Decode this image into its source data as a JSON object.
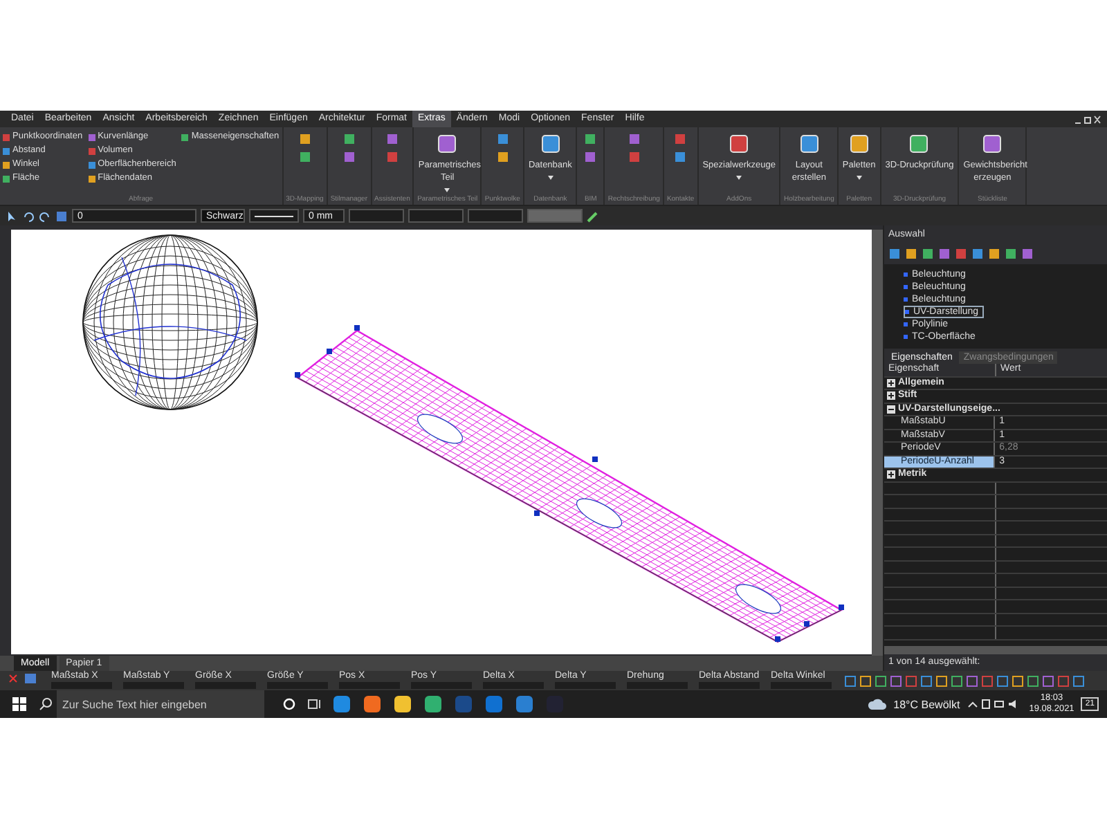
{
  "menu": [
    {
      "label": "Datei",
      "selected": false
    },
    {
      "label": "Bearbeiten",
      "selected": false
    },
    {
      "label": "Ansicht",
      "selected": false
    },
    {
      "label": "Arbeitsbereich",
      "selected": false
    },
    {
      "label": "Zeichnen",
      "selected": false
    },
    {
      "label": "Einfügen",
      "selected": false
    },
    {
      "label": "Architektur",
      "selected": false
    },
    {
      "label": "Format",
      "selected": false
    },
    {
      "label": "Extras",
      "selected": true
    },
    {
      "label": "Ändern",
      "selected": false
    },
    {
      "label": "Modi",
      "selected": false
    },
    {
      "label": "Optionen",
      "selected": false
    },
    {
      "label": "Fenster",
      "selected": false
    },
    {
      "label": "Hilfe",
      "selected": false
    }
  ],
  "ribbon": [
    {
      "label": "Abfrage",
      "kind": "small",
      "items": [
        "Punktkoordinaten",
        "Abstand",
        "Winkel",
        "Fläche",
        "Kurvenlänge",
        "Volumen",
        "Oberflächenbereich",
        "Flächendaten",
        "Masseneigenschaften"
      ]
    },
    {
      "label": "3D-Mapping",
      "kind": "icons"
    },
    {
      "label": "Stilmanager",
      "kind": "icons"
    },
    {
      "label": "Assistenten",
      "kind": "icons"
    },
    {
      "label": "Parametrisches Teil",
      "kind": "large",
      "button": "Parametrisches Teil",
      "dropdown": true
    },
    {
      "label": "Punktwolke",
      "kind": "icons"
    },
    {
      "label": "Datenbank",
      "kind": "large",
      "button": "Datenbank",
      "dropdown": true
    },
    {
      "label": "BIM",
      "kind": "icons"
    },
    {
      "label": "Rechtschreibung",
      "kind": "icons"
    },
    {
      "label": "Kontakte",
      "kind": "icons"
    },
    {
      "label": "AddOns",
      "kind": "large",
      "button": "Spezialwerkzeuge",
      "dropdown": true
    },
    {
      "label": "Holzbearbeitung",
      "kind": "large",
      "button": "Layout erstellen",
      "dropdown": false
    },
    {
      "label": "Paletten",
      "kind": "large",
      "button": "Paletten",
      "dropdown": true
    },
    {
      "label": "3D-Druckprüfung",
      "kind": "large",
      "button": "3D-Druckprüfung",
      "dropdown": false
    },
    {
      "label": "Stückliste",
      "kind": "large",
      "button": "Gewichtsbericht erzeugen",
      "dropdown": false
    }
  ],
  "toolbar": {
    "layer": "0",
    "pen": "Schwarz",
    "lineweight": "0 mm"
  },
  "selection_panel": {
    "title": "Auswahl",
    "tree": [
      {
        "label": "Beleuchtung",
        "selected": false
      },
      {
        "label": "Beleuchtung",
        "selected": false
      },
      {
        "label": "Beleuchtung",
        "selected": false
      },
      {
        "label": "UV-Darstellung",
        "selected": true
      },
      {
        "label": "Polylinie",
        "selected": false
      },
      {
        "label": "TC-Oberfläche",
        "selected": false
      }
    ],
    "tabs": [
      {
        "label": "Eigenschaften",
        "selected": true
      },
      {
        "label": "Zwangsbedingungen",
        "selected": false
      }
    ],
    "columns": [
      "Eigenschaft",
      "Wert"
    ],
    "sections": [
      {
        "label": "Allgemein",
        "expanded": false
      },
      {
        "label": "Stift",
        "expanded": false
      },
      {
        "label": "UV-Darstellungseige...",
        "expanded": true,
        "rows": [
          {
            "name": "MaßstabU",
            "value": "1",
            "disabled": false,
            "selected": false
          },
          {
            "name": "MaßstabV",
            "value": "1",
            "disabled": false,
            "selected": false
          },
          {
            "name": "PeriodeV",
            "value": "6,28",
            "disabled": true,
            "selected": false
          },
          {
            "name": "PeriodeU-Anzahl",
            "value": "3",
            "disabled": false,
            "selected": true
          }
        ]
      },
      {
        "label": "Metrik",
        "expanded": false
      }
    ],
    "status": "1 von 14 ausgewählt:"
  },
  "layout_tabs": [
    {
      "label": "Modell",
      "selected": true
    },
    {
      "label": "Papier 1",
      "selected": false
    }
  ],
  "coordinates": [
    "Maßstab X",
    "Maßstab Y",
    "Größe X",
    "Größe Y",
    "Pos X",
    "Pos Y",
    "Delta X",
    "Delta Y",
    "Drehung",
    "Delta Abstand",
    "Delta Winkel"
  ],
  "taskbar": {
    "search": {
      "placeholder": "Zur Suche Text hier eingeben"
    },
    "weather": "18°C Bewölkt",
    "time": "18:03",
    "date": "19.08.2021",
    "notifications": "21"
  }
}
